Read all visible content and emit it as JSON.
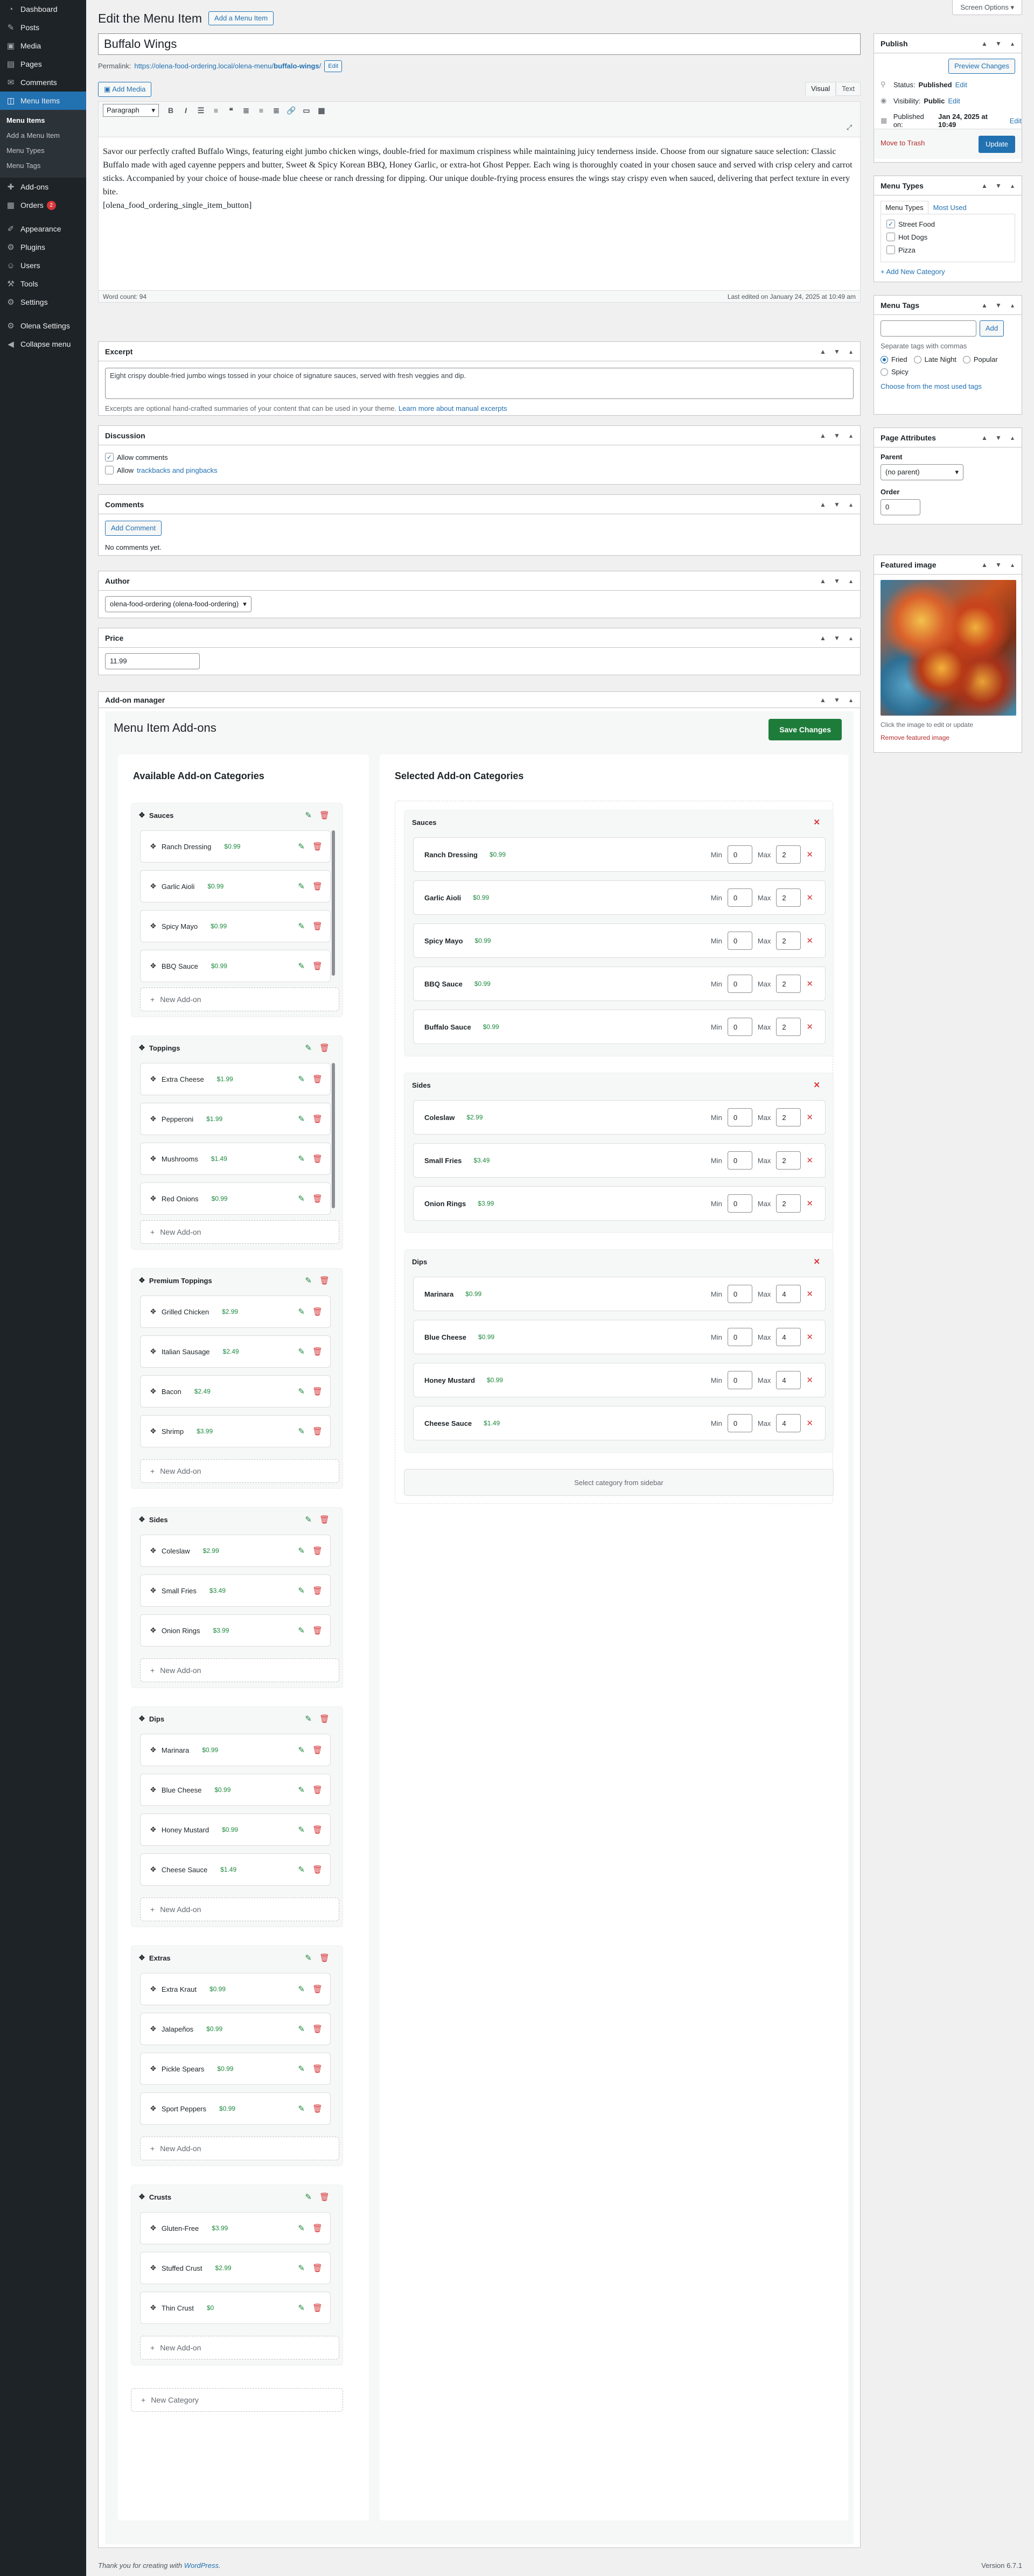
{
  "admin_menu": {
    "top": [
      {
        "label": "Dashboard",
        "icon": "dashboard-icon",
        "glyph": "◔"
      },
      {
        "label": "Posts",
        "icon": "posts-icon",
        "glyph": "✎"
      },
      {
        "label": "Media",
        "icon": "media-icon",
        "glyph": "▣"
      },
      {
        "label": "Pages",
        "icon": "pages-icon",
        "glyph": "▤"
      },
      {
        "label": "Comments",
        "icon": "comments-icon",
        "glyph": "✉"
      }
    ],
    "current": {
      "label": "Menu Items",
      "glyph": "◫"
    },
    "submenu": [
      "Menu Items",
      "Add a Menu Item",
      "Menu Types",
      "Menu Tags"
    ],
    "after": [
      {
        "label": "Add-ons",
        "icon": "addons-icon",
        "glyph": "✚"
      },
      {
        "label": "Orders",
        "icon": "orders-icon",
        "glyph": "▦",
        "badge": "2"
      }
    ],
    "lower": [
      {
        "label": "Appearance",
        "icon": "appearance-icon",
        "glyph": "✐"
      },
      {
        "label": "Plugins",
        "icon": "plugins-icon",
        "glyph": "⚙"
      },
      {
        "label": "Users",
        "icon": "users-icon",
        "glyph": "☺"
      },
      {
        "label": "Tools",
        "icon": "tools-icon",
        "glyph": "⚒"
      },
      {
        "label": "Settings",
        "icon": "settings-icon",
        "glyph": "⚙"
      }
    ],
    "bottom": [
      {
        "label": "Olena Settings",
        "icon": "olena-settings-icon",
        "glyph": "⚙"
      },
      {
        "label": "Collapse menu",
        "icon": "collapse-icon",
        "glyph": "◀"
      }
    ]
  },
  "screen_options": "Screen Options ▾",
  "page": {
    "heading": "Edit the Menu Item",
    "add_button": "Add a Menu Item",
    "title_value": "Buffalo Wings",
    "permalink_label": "Permalink:",
    "permalink_base": "https://olena-food-ordering.local/olena-menu/",
    "permalink_slug": "buffalo-wings",
    "permalink_end": "/",
    "permalink_edit": "Edit"
  },
  "editor": {
    "add_media": "Add Media",
    "tab_visual": "Visual",
    "tab_text": "Text",
    "format": "Paragraph",
    "content": "Savor our perfectly crafted Buffalo Wings, featuring eight jumbo chicken wings, double-fried for maximum crispiness while maintaining juicy tenderness inside. Choose from our signature sauce selection: Classic Buffalo made with aged cayenne peppers and butter, Sweet & Spicy Korean BBQ, Honey Garlic, or extra-hot Ghost Pepper. Each wing is thoroughly coated in your chosen sauce and served with crisp celery and carrot sticks. Accompanied by your choice of house-made blue cheese or ranch dressing for dipping. Our unique double-frying process ensures the wings stay crispy even when sauced, delivering that perfect texture in every bite.",
    "shortcode": "[olena_food_ordering_single_item_button]",
    "word_count": "Word count: 94",
    "last_edited": "Last edited on January 24, 2025 at 10:49 am"
  },
  "excerpt": {
    "title": "Excerpt",
    "value": "Eight crispy double-fried jumbo wings tossed in your choice of signature sauces, served with fresh veggies and dip.",
    "hint": "Excerpts are optional hand-crafted summaries of your content that can be used in your theme.",
    "hint_link": "Learn more about manual excerpts"
  },
  "discussion": {
    "title": "Discussion",
    "allow_comments": "Allow comments",
    "allow_prefix": "Allow",
    "trackbacks_link": "trackbacks and pingbacks"
  },
  "comments": {
    "title": "Comments",
    "add_button": "Add Comment",
    "none": "No comments yet."
  },
  "author": {
    "title": "Author",
    "value": "olena-food-ordering (olena-food-ordering)"
  },
  "price": {
    "title": "Price",
    "value": "11.99"
  },
  "addon_manager": {
    "box_title": "Add-on manager",
    "title": "Menu Item Add-ons",
    "save": "Save Changes",
    "available_title": "Available Add-on Categories",
    "selected_title": "Selected Add-on Categories",
    "new_addon": "New Add-on",
    "new_category": "New Category",
    "select_hint": "Select category from sidebar",
    "min_label": "Min",
    "max_label": "Max",
    "available": [
      {
        "name": "Sauces",
        "items": [
          {
            "n": "Ranch Dressing",
            "p": "$0.99"
          },
          {
            "n": "Garlic Aioli",
            "p": "$0.99"
          },
          {
            "n": "Spicy Mayo",
            "p": "$0.99"
          },
          {
            "n": "BBQ Sauce",
            "p": "$0.99"
          }
        ]
      },
      {
        "name": "Toppings",
        "items": [
          {
            "n": "Extra Cheese",
            "p": "$1.99"
          },
          {
            "n": "Pepperoni",
            "p": "$1.99"
          },
          {
            "n": "Mushrooms",
            "p": "$1.49"
          },
          {
            "n": "Red Onions",
            "p": "$0.99"
          }
        ]
      },
      {
        "name": "Premium Toppings",
        "items": [
          {
            "n": "Grilled Chicken",
            "p": "$2.99"
          },
          {
            "n": "Italian Sausage",
            "p": "$2.49"
          },
          {
            "n": "Bacon",
            "p": "$2.49"
          },
          {
            "n": "Shrimp",
            "p": "$3.99"
          }
        ]
      },
      {
        "name": "Sides",
        "items": [
          {
            "n": "Coleslaw",
            "p": "$2.99"
          },
          {
            "n": "Small Fries",
            "p": "$3.49"
          },
          {
            "n": "Onion Rings",
            "p": "$3.99"
          }
        ]
      },
      {
        "name": "Dips",
        "items": [
          {
            "n": "Marinara",
            "p": "$0.99"
          },
          {
            "n": "Blue Cheese",
            "p": "$0.99"
          },
          {
            "n": "Honey Mustard",
            "p": "$0.99"
          },
          {
            "n": "Cheese Sauce",
            "p": "$1.49"
          }
        ]
      },
      {
        "name": "Extras",
        "items": [
          {
            "n": "Extra Kraut",
            "p": "$0.99"
          },
          {
            "n": "Jalapeños",
            "p": "$0.99"
          },
          {
            "n": "Pickle Spears",
            "p": "$0.99"
          },
          {
            "n": "Sport Peppers",
            "p": "$0.99"
          }
        ]
      },
      {
        "name": "Crusts",
        "items": [
          {
            "n": "Gluten-Free",
            "p": "$3.99"
          },
          {
            "n": "Stuffed Crust",
            "p": "$2.99"
          },
          {
            "n": "Thin Crust",
            "p": "$0"
          }
        ]
      }
    ],
    "selected": [
      {
        "name": "Sauces",
        "items": [
          {
            "n": "Ranch Dressing",
            "p": "$0.99",
            "min": "0",
            "max": "2"
          },
          {
            "n": "Garlic Aioli",
            "p": "$0.99",
            "min": "0",
            "max": "2"
          },
          {
            "n": "Spicy Mayo",
            "p": "$0.99",
            "min": "0",
            "max": "2"
          },
          {
            "n": "BBQ Sauce",
            "p": "$0.99",
            "min": "0",
            "max": "2"
          },
          {
            "n": "Buffalo Sauce",
            "p": "$0.99",
            "min": "0",
            "max": "2"
          }
        ]
      },
      {
        "name": "Sides",
        "items": [
          {
            "n": "Coleslaw",
            "p": "$2.99",
            "min": "0",
            "max": "2"
          },
          {
            "n": "Small Fries",
            "p": "$3.49",
            "min": "0",
            "max": "2"
          },
          {
            "n": "Onion Rings",
            "p": "$3.99",
            "min": "0",
            "max": "2"
          }
        ]
      },
      {
        "name": "Dips",
        "items": [
          {
            "n": "Marinara",
            "p": "$0.99",
            "min": "0",
            "max": "4"
          },
          {
            "n": "Blue Cheese",
            "p": "$0.99",
            "min": "0",
            "max": "4"
          },
          {
            "n": "Honey Mustard",
            "p": "$0.99",
            "min": "0",
            "max": "4"
          },
          {
            "n": "Cheese Sauce",
            "p": "$1.49",
            "min": "0",
            "max": "4"
          }
        ]
      }
    ]
  },
  "publish": {
    "title": "Publish",
    "preview": "Preview Changes",
    "status_label": "Status:",
    "status_value": "Published",
    "visibility_label": "Visibility:",
    "visibility_value": "Public",
    "published_label": "Published on:",
    "published_value": "Jan 24, 2025 at 10:49",
    "edit": "Edit",
    "trash": "Move to Trash",
    "update": "Update"
  },
  "menu_types": {
    "title": "Menu Types",
    "tab_all": "Menu Types",
    "tab_used": "Most Used",
    "items": [
      {
        "label": "Street Food",
        "checked": true
      },
      {
        "label": "Hot Dogs",
        "checked": false
      },
      {
        "label": "Pizza",
        "checked": false
      }
    ],
    "add_new": "+ Add New Category"
  },
  "menu_tags": {
    "title": "Menu Tags",
    "add": "Add",
    "hint": "Separate tags with commas",
    "tags": [
      "Fried",
      "Late Night",
      "Popular",
      "Spicy"
    ],
    "choose": "Choose from the most used tags"
  },
  "page_attributes": {
    "title": "Page Attributes",
    "parent_label": "Parent",
    "parent_value": "(no parent)",
    "order_label": "Order",
    "order_value": "0"
  },
  "featured_image": {
    "title": "Featured image",
    "hint": "Click the image to edit or update",
    "remove": "Remove featured image"
  },
  "footer": {
    "left": "Thank you for creating with",
    "link": "WordPress",
    "right": "Version 6.7.1"
  }
}
